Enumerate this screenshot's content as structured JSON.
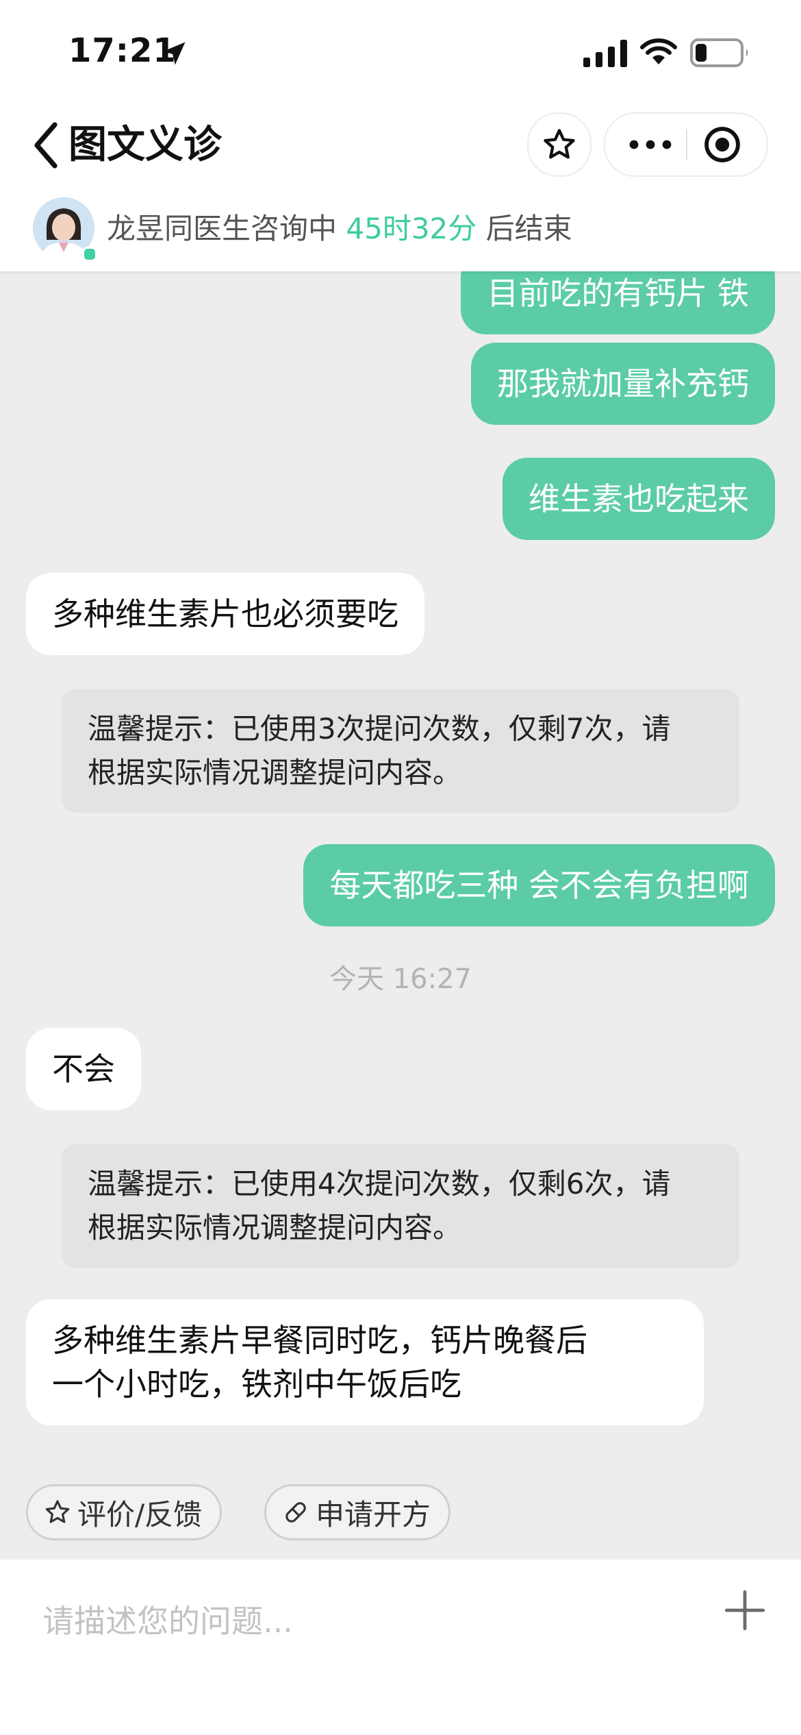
{
  "status_bar": {
    "time": "17:21"
  },
  "nav": {
    "title": "图文义诊"
  },
  "doctor_banner": {
    "doctor_status": "龙昱同医生咨询中",
    "remaining_time": "45时32分",
    "suffix": "后结束"
  },
  "messages": {
    "m0": "目前吃的有钙片 铁",
    "m1": "那我就加量补充钙",
    "m2": "维生素也吃起来",
    "m3": "多种维生素片也必须要吃",
    "tip1_line1": "温馨提示：已使用3次提问次数，仅剩7次，请",
    "tip1_line2": "根据实际情况调整提问内容。",
    "m4": "每天都吃三种 会不会有负担啊",
    "timestamp": "今天 16:27",
    "m5": "不会",
    "tip2_line1": "温馨提示：已使用4次提问次数，仅剩6次，请",
    "tip2_line2": "根据实际情况调整提问内容。",
    "m6_line1": "多种维生素片早餐同时吃，钙片晚餐后",
    "m6_line2": "一个小时吃，铁剂中午饭后吃"
  },
  "actions": {
    "feedback_label": "评价/反馈",
    "prescription_label": "申请开方"
  },
  "input": {
    "placeholder": "请描述您的问题..."
  },
  "colors": {
    "accent": "#3dcc9e",
    "outgoing_bubble": "#5bcca6",
    "chat_background": "#ededed"
  },
  "icons": [
    "location-arrow-icon",
    "signal-icon",
    "wifi-icon",
    "battery-icon",
    "back-icon",
    "star-icon",
    "more-icon",
    "target-icon",
    "avatar",
    "star-outline-icon",
    "pill-icon",
    "plus-icon"
  ]
}
